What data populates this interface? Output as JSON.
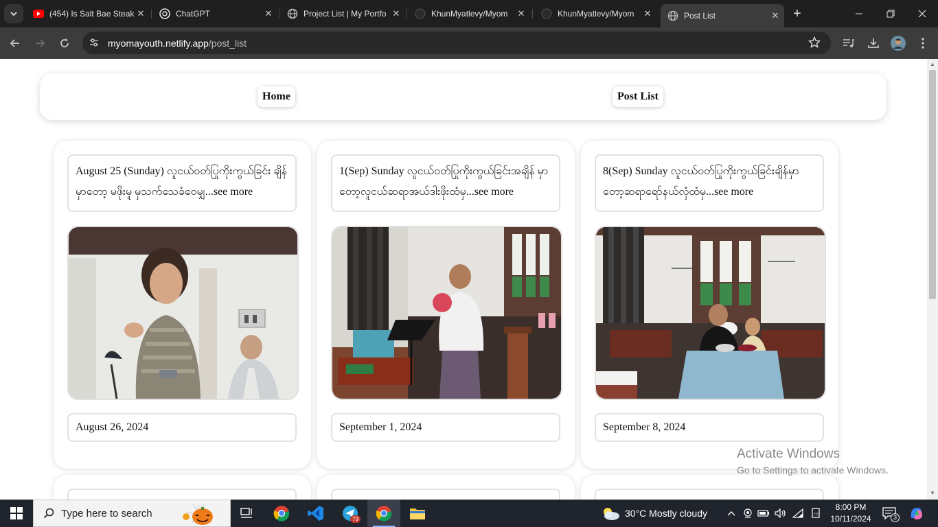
{
  "browser": {
    "tabs": [
      {
        "title": "(454) Is Salt Bae Steak",
        "favicon": "youtube-icon"
      },
      {
        "title": "ChatGPT",
        "favicon": "chatgpt-icon"
      },
      {
        "title": "Project List | My Portfo",
        "favicon": "globe-icon"
      },
      {
        "title": "KhunMyatlevy/Myom",
        "favicon": "github-icon"
      },
      {
        "title": "KhunMyatlevy/Myom",
        "favicon": "github-icon"
      },
      {
        "title": "Post List",
        "favicon": "globe-icon"
      }
    ],
    "active_tab_index": 5,
    "url_domain": "myomayouth.netlify.app",
    "url_path": "/post_list"
  },
  "nav": {
    "home_label": "Home",
    "post_list_label": "Post List"
  },
  "posts": [
    {
      "title": "August 25 (Sunday) လူငယ်ဝတ်ပြုကိုးကွယ်ခြင်း ချိန်မှာတော့ မဖိုးမူ မှသက်သေခံဝေမျှ...see more",
      "date": "August 26, 2024"
    },
    {
      "title": "1(Sep) Sunday လူငယ်ဝတ်ပြုကိုးကွယ်ခြင်းအချိန် မှာတော့လူငယ်ဆရာအယ်ဒါးဖိုးထံမှ...see more",
      "date": "September 1, 2024"
    },
    {
      "title": "8(Sep) Sunday လူငယ်ဝတ်ပြုကိုးကွယ်ခြင်းချိန်မှာ တော့ဆရာရော်နယ်လှံထံမှ...see more",
      "date": "September 8, 2024"
    }
  ],
  "watermark": {
    "line1": "Activate Windows",
    "line2": "Go to Settings to activate Windows."
  },
  "taskbar": {
    "search_placeholder": "Type here to search",
    "telegram_badge": "79",
    "weather": "30°C  Mostly cloudy",
    "time": "8:00 PM",
    "date": "10/11/2024",
    "notification_count": "3"
  }
}
